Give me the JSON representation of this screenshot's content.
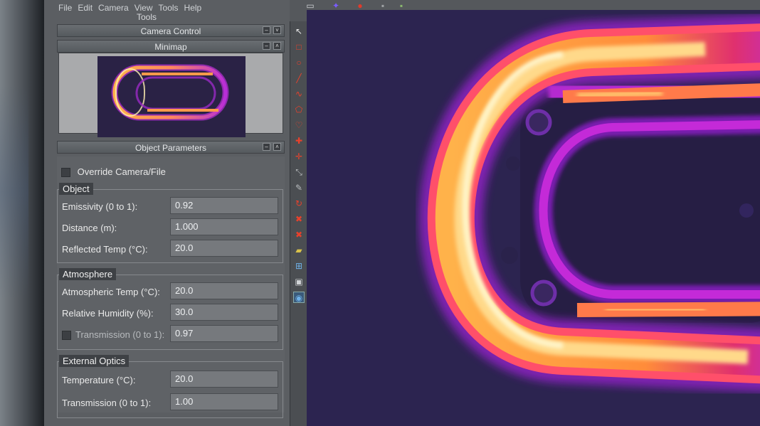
{
  "menu": [
    "File",
    "Edit",
    "Camera",
    "View",
    "Tools",
    "Help"
  ],
  "tools_title": "Tools",
  "camera_control": {
    "title": "Camera Control"
  },
  "minimap": {
    "title": "Minimap"
  },
  "object_parameters": {
    "title": "Object Parameters",
    "override_label": "Override Camera/File",
    "object": {
      "label": "Object",
      "emissivity": {
        "label": "Emissivity (0 to 1):",
        "value": "0.92"
      },
      "distance": {
        "label": "Distance (m):",
        "value": "1.000"
      },
      "reflected_temp": {
        "label": "Reflected Temp (°C):",
        "value": "20.0"
      }
    },
    "atmosphere": {
      "label": "Atmosphere",
      "atmospheric_temp": {
        "label": "Atmospheric Temp (°C):",
        "value": "20.0"
      },
      "relative_humidity": {
        "label": "Relative Humidity (%):",
        "value": "30.0"
      },
      "transmission": {
        "label": "Transmission (0 to 1):",
        "value": "0.97"
      }
    },
    "external_optics": {
      "label": "External Optics",
      "temperature": {
        "label": "Temperature (°C):",
        "value": "20.0"
      },
      "transmission": {
        "label": "Transmission (0 to 1):",
        "value": "1.00"
      }
    }
  },
  "colors": {
    "thermal_background": "#2c2450",
    "hot_core": "#fff4c8",
    "hot": "#ffb24a",
    "warm": "#ff5a6e",
    "cool": "#b82dd8",
    "tool_red": "#e8412c"
  },
  "toolbar_icons": [
    "cursor-icon",
    "rectangle-icon",
    "ellipse-icon",
    "line-icon",
    "polyline-icon",
    "polygon-icon",
    "isotherm-icon",
    "max-spot-icon",
    "min-spot-icon",
    "measure-icon",
    "color-picker-icon",
    "refresh-icon",
    "delete-icon",
    "delete-all-icon",
    "open-icon",
    "import-icon",
    "save-icon",
    "view-icon"
  ]
}
